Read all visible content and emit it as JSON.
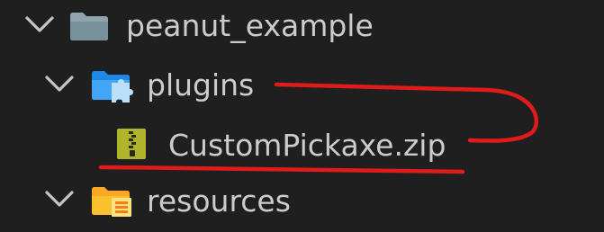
{
  "explorer": {
    "root": {
      "label": "peanut_example",
      "icon": "folder-icon",
      "expanded": true
    },
    "items": [
      {
        "label": "plugins",
        "icon": "plugin-folder-icon",
        "expanded": true,
        "children": [
          {
            "label": "CustomPickaxe.zip",
            "icon": "zip-file-icon"
          }
        ]
      },
      {
        "label": "resources",
        "icon": "resources-folder-icon",
        "expanded": true
      }
    ]
  },
  "colors": {
    "background": "#1f1f1f",
    "text": "#cccccc",
    "chevron": "#c5c5c5",
    "folder_gray": "#90a4ae",
    "plugin_folder_blue": "#42a5f5",
    "resources_folder_yellow": "#fbc02d",
    "zip_icon": "#afb42b",
    "annotation_red": "#e01b1b"
  }
}
